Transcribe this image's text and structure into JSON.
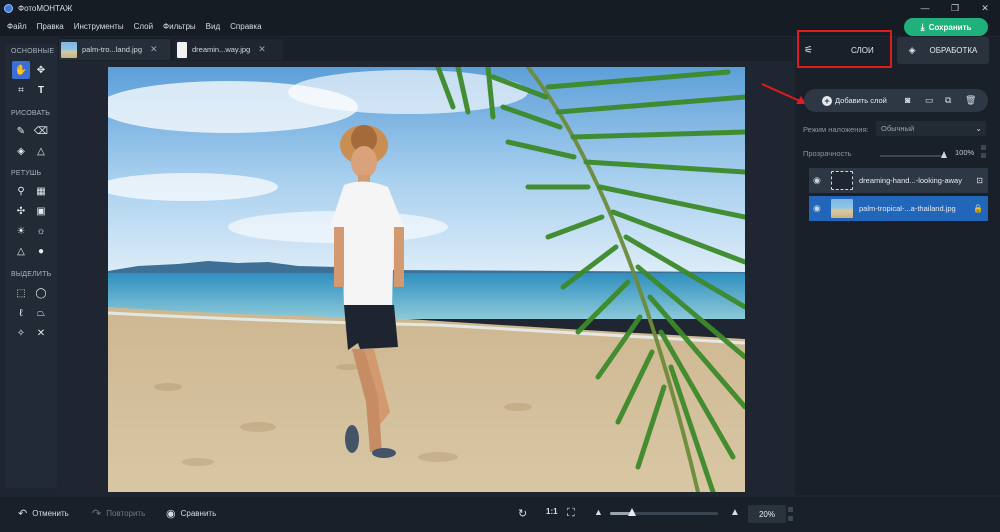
{
  "app": {
    "title": "ФотоМОНТАЖ"
  },
  "window_controls": {
    "minimize": "—",
    "restore": "❐",
    "close": "✕"
  },
  "menu": {
    "items": [
      "Файл",
      "Правка",
      "Инструменты",
      "Слой",
      "Фильтры",
      "Вид",
      "Справка"
    ]
  },
  "save_button": {
    "label": "Сохранить",
    "icon": "download-icon"
  },
  "toolbox": {
    "sections": [
      {
        "label": "ОСНОВНЫЕ",
        "tools": [
          "hand-icon",
          "move-icon",
          "crop-icon",
          "text-icon"
        ]
      },
      {
        "label": "РИСОВАТЬ",
        "tools": [
          "brush-icon",
          "eraser-icon",
          "fill-icon",
          "shapes-icon"
        ]
      },
      {
        "label": "РЕТУШЬ",
        "tools": [
          "stamp-icon",
          "patch-icon",
          "heal-icon",
          "frame-icon",
          "brightness-icon",
          "lighten-icon",
          "sharpen-icon",
          "drop-icon"
        ]
      },
      {
        "label": "ВЫДЕЛИТЬ",
        "tools": [
          "rect-select-icon",
          "ellipse-select-icon",
          "lasso-icon",
          "polygon-lasso-icon",
          "magic-lasso-icon",
          "magic-wand-icon"
        ]
      }
    ]
  },
  "doc_tabs": [
    {
      "name": "palm-tro...land.jpg",
      "close": "✕",
      "active": true
    },
    {
      "name": "dreamin...way.jpg",
      "close": "✕",
      "active": false
    }
  ],
  "bottom": {
    "undo": "Отменить",
    "redo": "Повторить",
    "compare": "Сравнить",
    "ratio": "1:1",
    "zoom_percent": 0.2,
    "zoom_label": "20%"
  },
  "right_panel": {
    "tabs": {
      "layers": "СЛОИ",
      "processing": "ОБРАБОТКА"
    },
    "add_layer": "Добавить слой",
    "blend_label": "Режим наложения:",
    "blend_value": "Обычный",
    "opacity_label": "Прозрачность",
    "opacity_value": "100%",
    "opacity_fraction": 1.0,
    "layers": [
      {
        "name": "dreaming-hand...-looking-away",
        "locked": false
      },
      {
        "name": "palm-tropical-...a-thailand.jpg",
        "locked": true
      }
    ]
  },
  "colors": {
    "accent": "#2166b8",
    "save": "#1fb07c",
    "highlight": "#e01b1b"
  }
}
